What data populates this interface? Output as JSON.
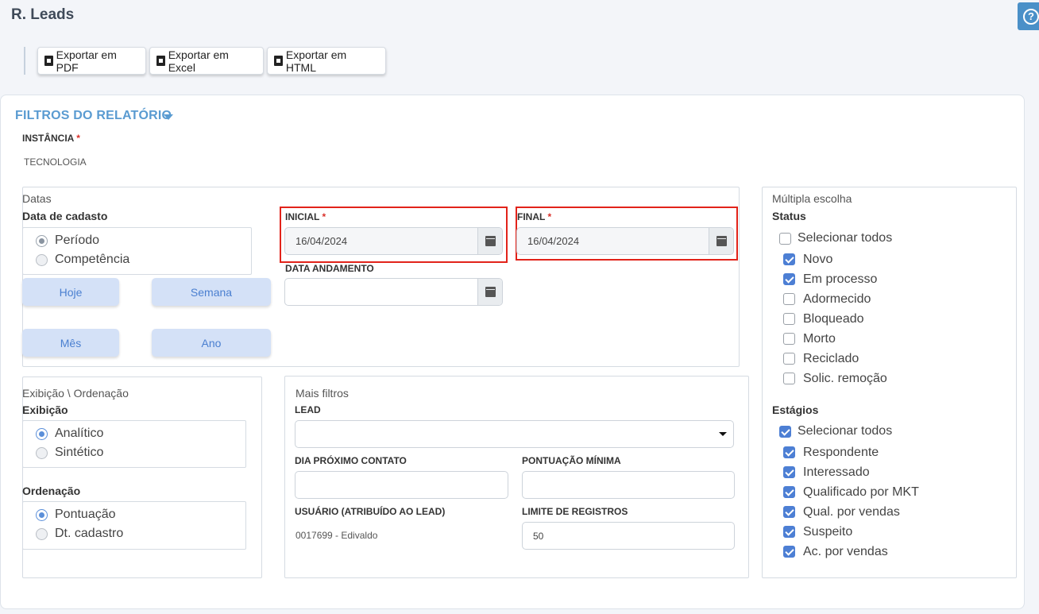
{
  "page": {
    "title": "R. Leads",
    "help_icon": "?"
  },
  "toolbar": {
    "export_pdf": "Exportar em PDF",
    "export_excel": "Exportar em Excel",
    "export_html": "Exportar em HTML"
  },
  "filters": {
    "title": "FILTROS DO RELATÓRIO",
    "instancia_label": "INSTÂNCIA",
    "instancia_value": "TECNOLOGIA",
    "required_mark": "*",
    "datas": {
      "legend": "Datas",
      "data_cadastro_label": "Data de cadasto",
      "options": [
        "Período",
        "Competência"
      ],
      "quick": {
        "hoje": "Hoje",
        "semana": "Semana",
        "mes": "Mês",
        "ano": "Ano"
      },
      "inicial_label": "INICIAL",
      "inicial_value": "16/04/2024",
      "final_label": "FINAL",
      "final_value": "16/04/2024",
      "andamento_label": "DATA ANDAMENTO",
      "andamento_value": ""
    },
    "exibicao": {
      "legend": "Exibição \\ Ordenação",
      "exibicao_label": "Exibição",
      "exibicao_options": [
        "Analítico",
        "Sintético"
      ],
      "ordenacao_label": "Ordenação",
      "ordenacao_options": [
        "Pontuação",
        "Dt. cadastro"
      ]
    },
    "mais": {
      "legend": "Mais filtros",
      "lead_label": "LEAD",
      "lead_value": "",
      "dia_contato_label": "DIA PRÓXIMO CONTATO",
      "pontuacao_label": "PONTUAÇÃO MÍNIMA",
      "usuario_label": "USUÁRIO (ATRIBUÍDO AO LEAD)",
      "usuario_value": "0017699 - Edivaldo",
      "limite_label": "LIMITE DE REGISTROS",
      "limite_value": "50"
    },
    "multipla": {
      "legend": "Múltipla escolha",
      "status_label": "Status",
      "status_all": "Selecionar todos",
      "status_items": [
        "Novo",
        "Em processo",
        "Adormecido",
        "Bloqueado",
        "Morto",
        "Reciclado",
        "Solic. remoção"
      ],
      "estagios_label": "Estágios",
      "estagios_all": "Selecionar todos",
      "estagios_items": [
        "Respondente",
        "Interessado",
        "Qualificado por MKT",
        "Qual. por vendas",
        "Suspeito",
        "Ac. por vendas"
      ]
    }
  }
}
